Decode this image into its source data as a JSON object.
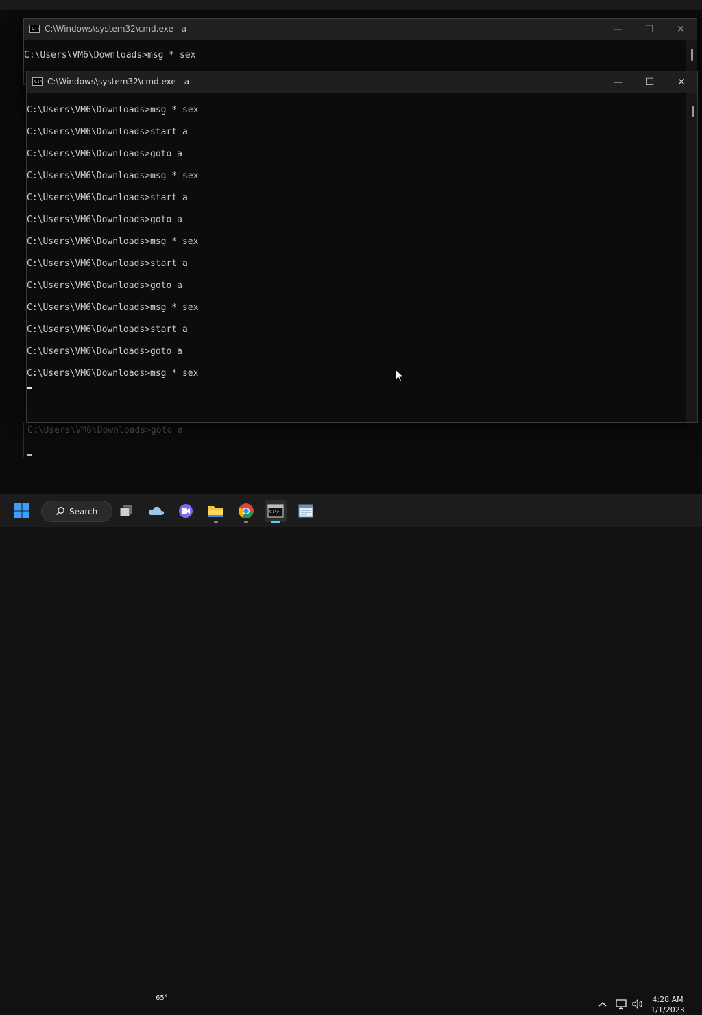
{
  "window_back": {
    "title": "C:\\Windows\\system32\\cmd.exe - a",
    "top_line": "C:\\Users\\VM6\\Downloads>msg * sex",
    "lower_dim_line": "C:\\Users\\VM6\\Downloads>goto a"
  },
  "window_front": {
    "title": "C:\\Windows\\system32\\cmd.exe - a",
    "lines": [
      "C:\\Users\\VM6\\Downloads>msg * sex",
      "C:\\Users\\VM6\\Downloads>start a",
      "C:\\Users\\VM6\\Downloads>goto a",
      "C:\\Users\\VM6\\Downloads>msg * sex",
      "C:\\Users\\VM6\\Downloads>start a",
      "C:\\Users\\VM6\\Downloads>goto a",
      "C:\\Users\\VM6\\Downloads>msg * sex",
      "C:\\Users\\VM6\\Downloads>start a",
      "C:\\Users\\VM6\\Downloads>goto a",
      "C:\\Users\\VM6\\Downloads>msg * sex",
      "C:\\Users\\VM6\\Downloads>start a",
      "C:\\Users\\VM6\\Downloads>goto a",
      "C:\\Users\\VM6\\Downloads>msg * sex"
    ]
  },
  "titlebar_buttons": {
    "minimize": "—",
    "maximize": "☐",
    "close": "✕"
  },
  "taskbar": {
    "search_label": "Search",
    "weather_temp": "65°",
    "apps": [
      "start-icon",
      "task-view-icon",
      "weather-icon",
      "chat-icon",
      "file-explorer-icon",
      "chrome-icon",
      "terminal-icon",
      "notepad-icon"
    ],
    "active_app": "terminal-icon"
  },
  "tray": {
    "time": "4:28 AM",
    "date": "1/1/2023"
  },
  "colors": {
    "console_bg": "#0c0c0c",
    "console_text": "#cccccc",
    "titlebar": "#1f1f1f",
    "taskbar": "#1c1c1c",
    "active_indicator": "#60cdff"
  }
}
